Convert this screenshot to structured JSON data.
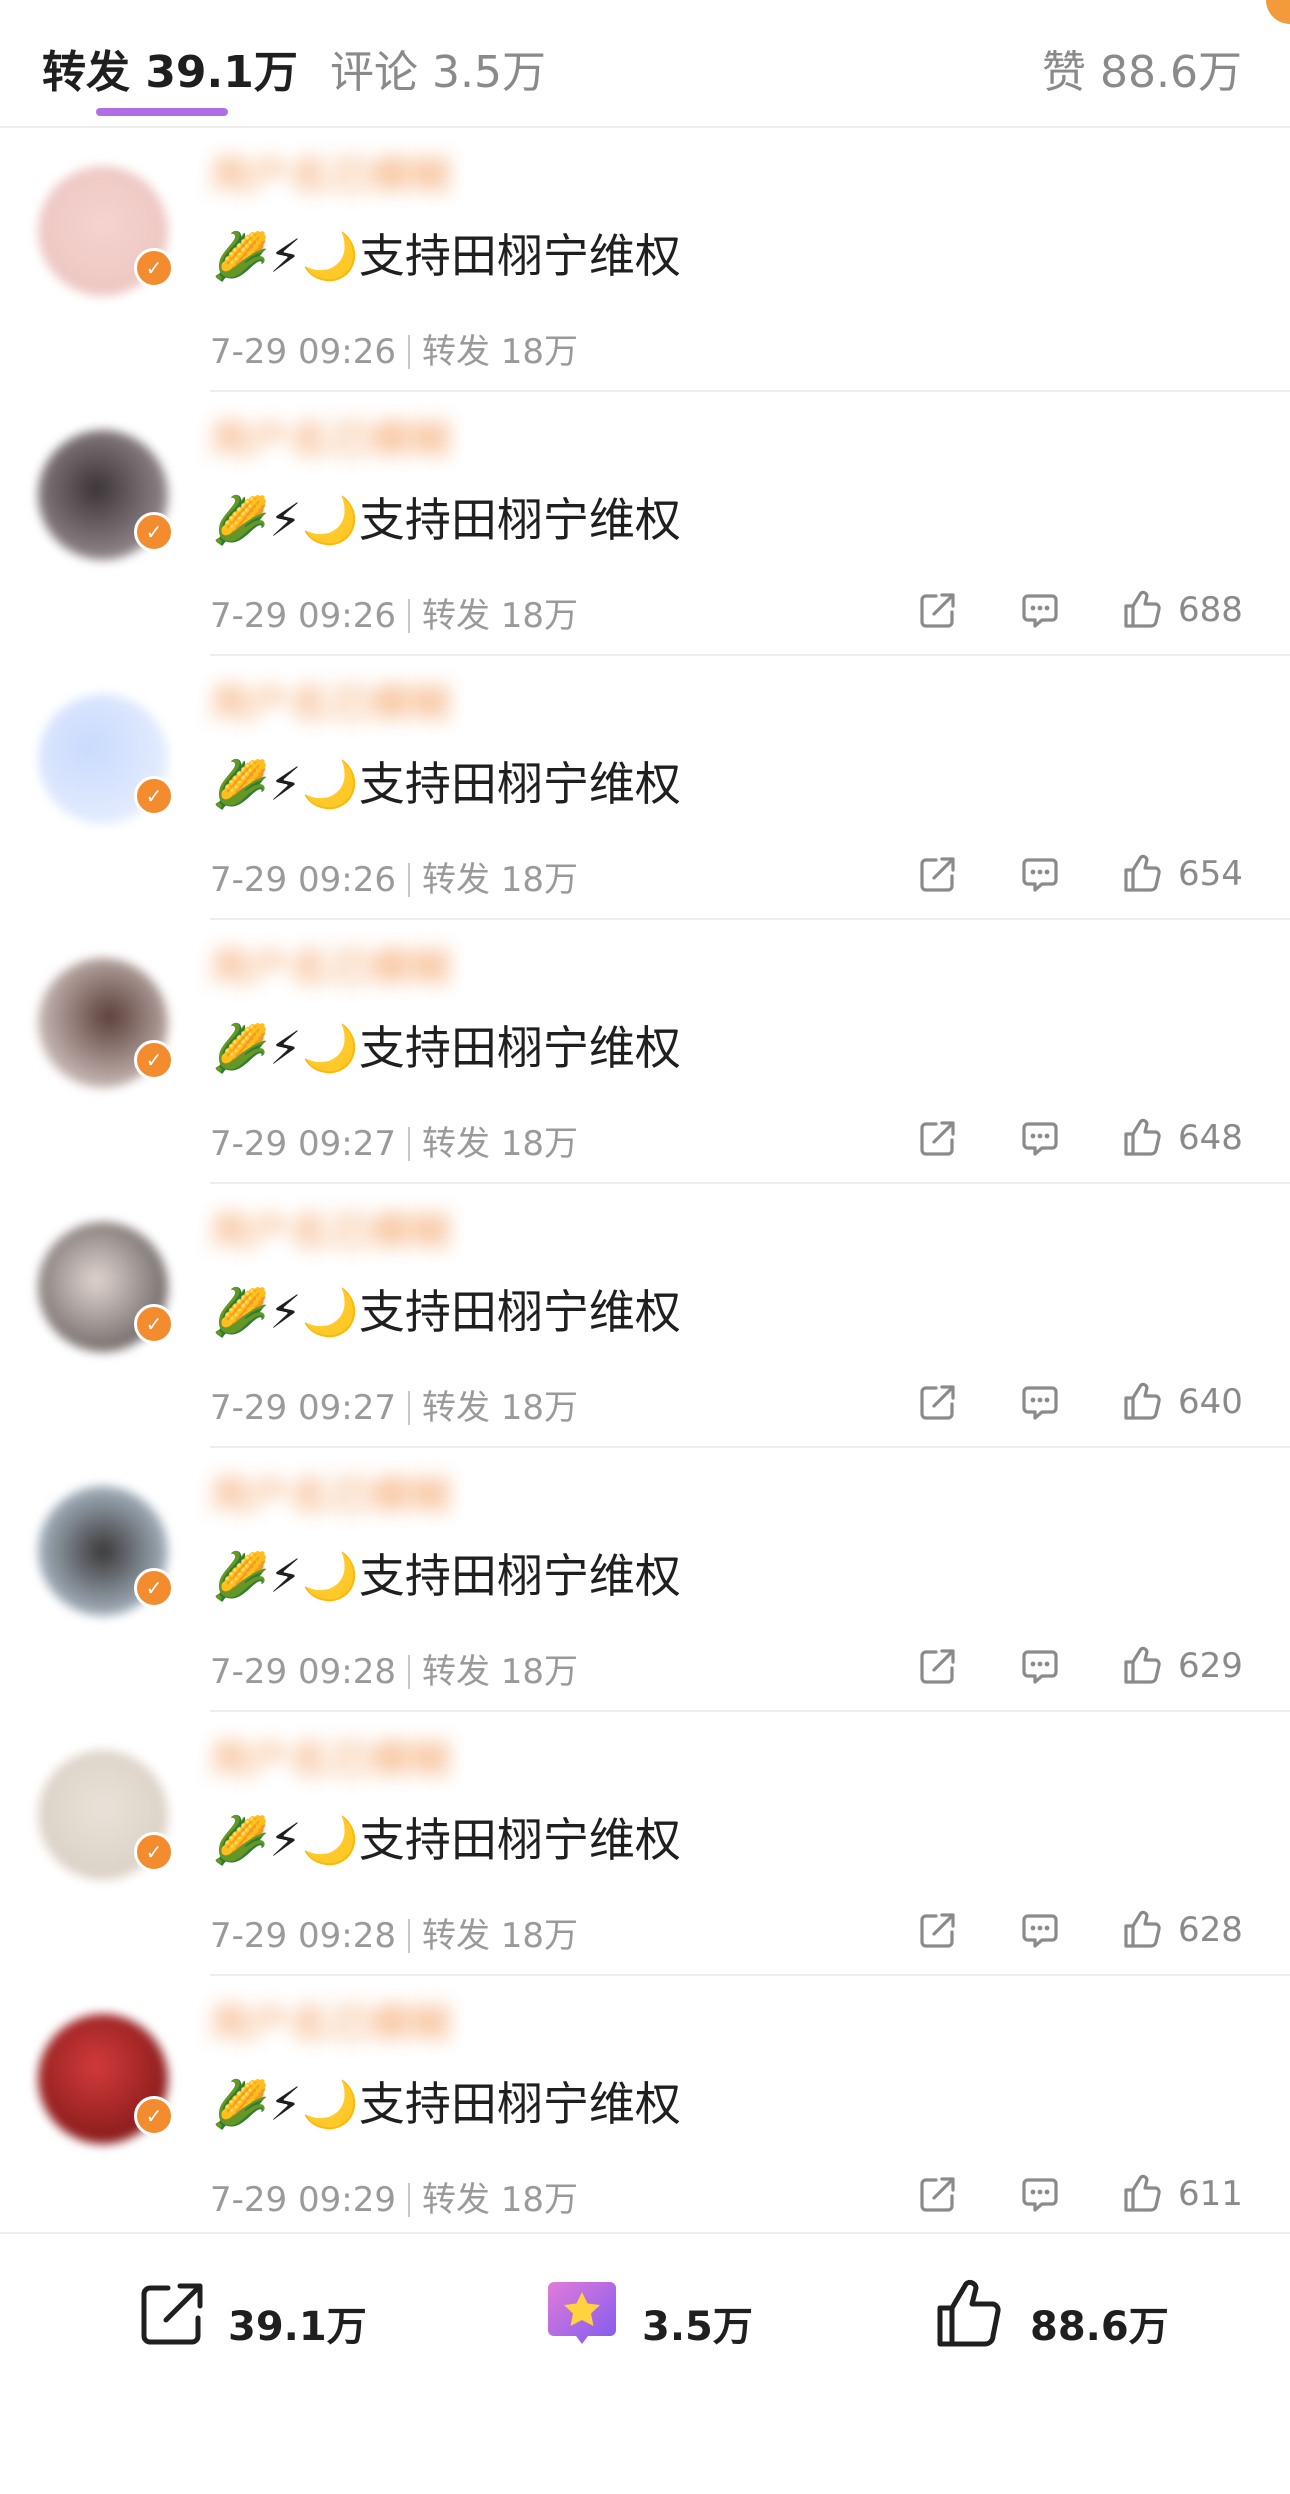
{
  "tabs": {
    "repost": "转发 39.1万",
    "comment": "评论 3.5万",
    "like": "赞 88.6万"
  },
  "colors": {
    "accent": "#b06ee6",
    "username": "#f08a3c",
    "badge": "#f38b2f"
  },
  "posts": [
    {
      "name": "用户名已模糊",
      "content": "🌽⚡🌙支持田栩宁维权",
      "time": "7-29 09:26",
      "repost": "转发 18万",
      "likes": ""
    },
    {
      "name": "用户名已模糊",
      "content": "🌽⚡🌙支持田栩宁维权",
      "time": "7-29 09:26",
      "repost": "转发 18万",
      "likes": "688"
    },
    {
      "name": "用户名已模糊",
      "content": "🌽⚡🌙支持田栩宁维权",
      "time": "7-29 09:26",
      "repost": "转发 18万",
      "likes": "654"
    },
    {
      "name": "用户名已模糊",
      "content": "🌽⚡🌙支持田栩宁维权",
      "time": "7-29 09:27",
      "repost": "转发 18万",
      "likes": "648"
    },
    {
      "name": "用户名已模糊",
      "content": "🌽⚡🌙支持田栩宁维权",
      "time": "7-29 09:27",
      "repost": "转发 18万",
      "likes": "640"
    },
    {
      "name": "用户名已模糊",
      "content": "🌽⚡🌙支持田栩宁维权",
      "time": "7-29 09:28",
      "repost": "转发 18万",
      "likes": "629"
    },
    {
      "name": "用户名已模糊",
      "content": "🌽⚡🌙支持田栩宁维权",
      "time": "7-29 09:28",
      "repost": "转发 18万",
      "likes": "628"
    },
    {
      "name": "用户名已模糊",
      "content": "🌽⚡🌙支持田栩宁维权",
      "time": "7-29 09:29",
      "repost": "转发 18万",
      "likes": "611"
    }
  ],
  "bottom_bar": {
    "share": "39.1万",
    "star": "3.5万",
    "like": "88.6万"
  }
}
